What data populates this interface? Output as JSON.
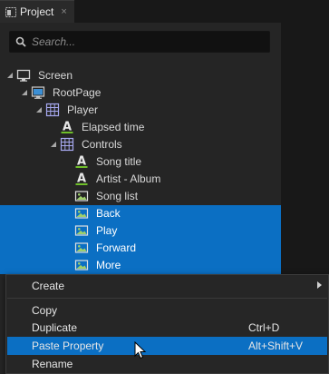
{
  "tab": {
    "title": "Project",
    "close": "×"
  },
  "search": {
    "placeholder": "Search..."
  },
  "tree": [
    {
      "label": "Screen",
      "icon": "monitor-icon",
      "indent": 0,
      "caret": true,
      "selected": false
    },
    {
      "label": "RootPage",
      "icon": "page-icon",
      "indent": 1,
      "caret": true,
      "selected": false
    },
    {
      "label": "Player",
      "icon": "grid-node-icon",
      "indent": 2,
      "caret": true,
      "selected": false
    },
    {
      "label": "Elapsed time",
      "icon": "text-node-icon",
      "indent": 3,
      "caret": false,
      "selected": false
    },
    {
      "label": "Controls",
      "icon": "grid-node-icon",
      "indent": 3,
      "caret": true,
      "selected": false
    },
    {
      "label": "Song title",
      "icon": "text-node-icon",
      "indent": 4,
      "caret": false,
      "selected": false
    },
    {
      "label": "Artist - Album",
      "icon": "text-node-icon",
      "indent": 4,
      "caret": false,
      "selected": false
    },
    {
      "label": "Song list",
      "icon": "image-node-icon",
      "indent": 4,
      "caret": false,
      "selected": false
    },
    {
      "label": "Back",
      "icon": "image-node-icon",
      "indent": 4,
      "caret": false,
      "selected": true
    },
    {
      "label": "Play",
      "icon": "image-node-icon",
      "indent": 4,
      "caret": false,
      "selected": true
    },
    {
      "label": "Forward",
      "icon": "image-node-icon",
      "indent": 4,
      "caret": false,
      "selected": true
    },
    {
      "label": "More",
      "icon": "image-node-icon",
      "indent": 4,
      "caret": false,
      "selected": true
    }
  ],
  "context_menu": {
    "items": [
      {
        "label": "Create",
        "shortcut": "",
        "submenu": true,
        "highlighted": false
      },
      {
        "label": "Copy",
        "shortcut": "",
        "submenu": false,
        "highlighted": false
      },
      {
        "label": "Duplicate",
        "shortcut": "Ctrl+D",
        "submenu": false,
        "highlighted": false
      },
      {
        "label": "Paste Property",
        "shortcut": "Alt+Shift+V",
        "submenu": false,
        "highlighted": true
      },
      {
        "label": "Rename",
        "shortcut": "",
        "submenu": false,
        "highlighted": false
      }
    ]
  },
  "colors": {
    "selection": "#0b6fc3",
    "panel": "#252525",
    "text_icon": "#e8e8e8",
    "text_icon_underline": "#6fbf2a"
  }
}
